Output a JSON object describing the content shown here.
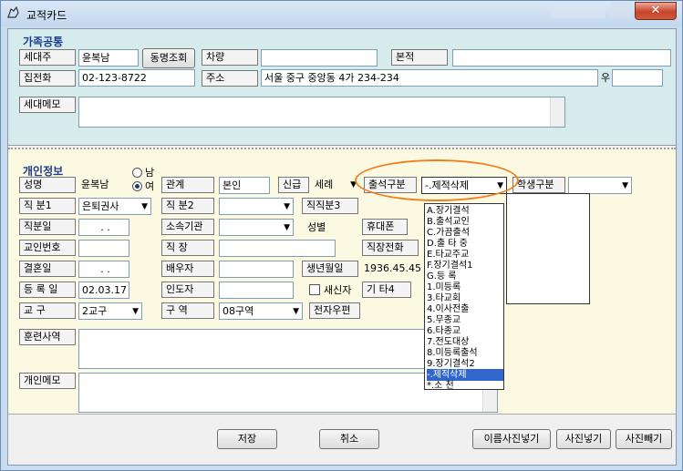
{
  "window": {
    "title": "교적카드",
    "close_glyph": "✕"
  },
  "family": {
    "section_title": "가족공통",
    "householder_label": "세대주",
    "householder_value": "윤복남",
    "same_name_button": "동명조회",
    "car_label": "차량",
    "car_value": "",
    "domicile_label": "본적",
    "domicile_value": "",
    "home_phone_label": "집전화",
    "home_phone_value": "02-123-8722",
    "address_label": "주소",
    "address_value": "서울 중구 중앙동 4가 234-234",
    "zip_label": "우",
    "zip_value": "",
    "memo_label": "세대메모",
    "memo_value": ""
  },
  "personal": {
    "section_title": "개인정보",
    "name_label": "성명",
    "name_value": "윤복남",
    "gender_male": "남",
    "gender_female": "여",
    "relation_label": "관계",
    "relation_value": "본인",
    "new_label": "신급",
    "new_value": "세례",
    "attendance_label": "출석구분",
    "attendance_value": "-.제적삭제",
    "student_label": "학생구분",
    "student_value": "",
    "position1_label": "직 분1",
    "position1_value": "은퇴권사",
    "position2_label": "직 분2",
    "position2_value": "",
    "position3_label": "직직분3",
    "office_day_label": "직분일",
    "office_day_value": ". .",
    "org_label": "소속기관",
    "org_value": "",
    "gender_label": "성별",
    "mobile_label": "휴대폰",
    "friend_label": "교인번호",
    "friend_value": "",
    "work_label": "직 장",
    "work_value": "",
    "work_phone_label": "직장전화",
    "wedding_label": "결혼일",
    "wedding_value": ". .",
    "spouse_label": "배우자",
    "spouse_value": "",
    "birth_label": "생년월일",
    "birth_value": "1936.45.45",
    "reg_label": "등 록 일",
    "reg_value": "02.03.17",
    "guide_label": "인도자",
    "guide_value": "",
    "newbie_label": "새신자",
    "etc_label": "기 타4",
    "district_label": "교 구",
    "district_value": "2교구",
    "area_label": "구 역",
    "area_value": "08구역",
    "email_label": "전자우편",
    "training_label": "훈련사역",
    "training_value": "",
    "memo_label": "개인메모",
    "memo_value": ""
  },
  "attendance_options": [
    "A.장기결석",
    "B.출석교인",
    "C.가끔출석",
    "D.출 타 중",
    "E.타교주교",
    "F.장기결석1",
    "G.등   록",
    "1.미등록",
    "3.타교회",
    "4.이사전출",
    "5.무종교",
    "6.타종교",
    "7.전도대상",
    "8.미등록출석",
    "9.장기결석2",
    "-.제적삭제",
    "*.소   천"
  ],
  "buttons": {
    "save": "저장",
    "cancel": "취소",
    "name_photo": "이름사진넣기",
    "photo_in": "사진넣기",
    "photo_out": "사진빼기"
  }
}
